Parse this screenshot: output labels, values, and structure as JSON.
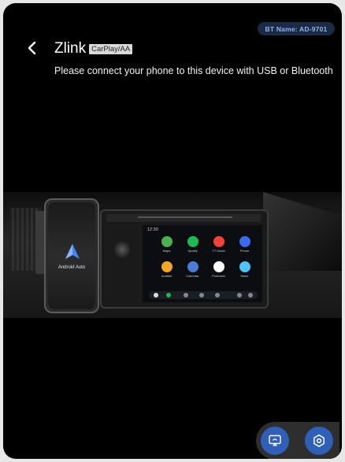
{
  "header": {
    "bt_name": "BT Name:  AD-9701",
    "title": "Zlink",
    "title_tag": "CarPlay/AA",
    "subtitle": "Please connect your phone to this device with USB or Bluetooth"
  },
  "illustration": {
    "phone_label": "Android Auto",
    "screen_time": "12:30",
    "apps": [
      "Maps",
      "Spotify",
      "YT Music",
      "Phone",
      "Audible",
      "Calendar",
      "Podcasts",
      "Waze"
    ],
    "app_colors": [
      "#4caf50",
      "#1db954",
      "#f44336",
      "#3b6cf0",
      "#f5a623",
      "#4a7bd6",
      "#ffffff",
      "#4fc3f7"
    ]
  },
  "fabs": {
    "cast_icon": "cast-screen-icon",
    "settings_icon": "settings-hexagon-icon",
    "accent": "#2f5fb6"
  }
}
